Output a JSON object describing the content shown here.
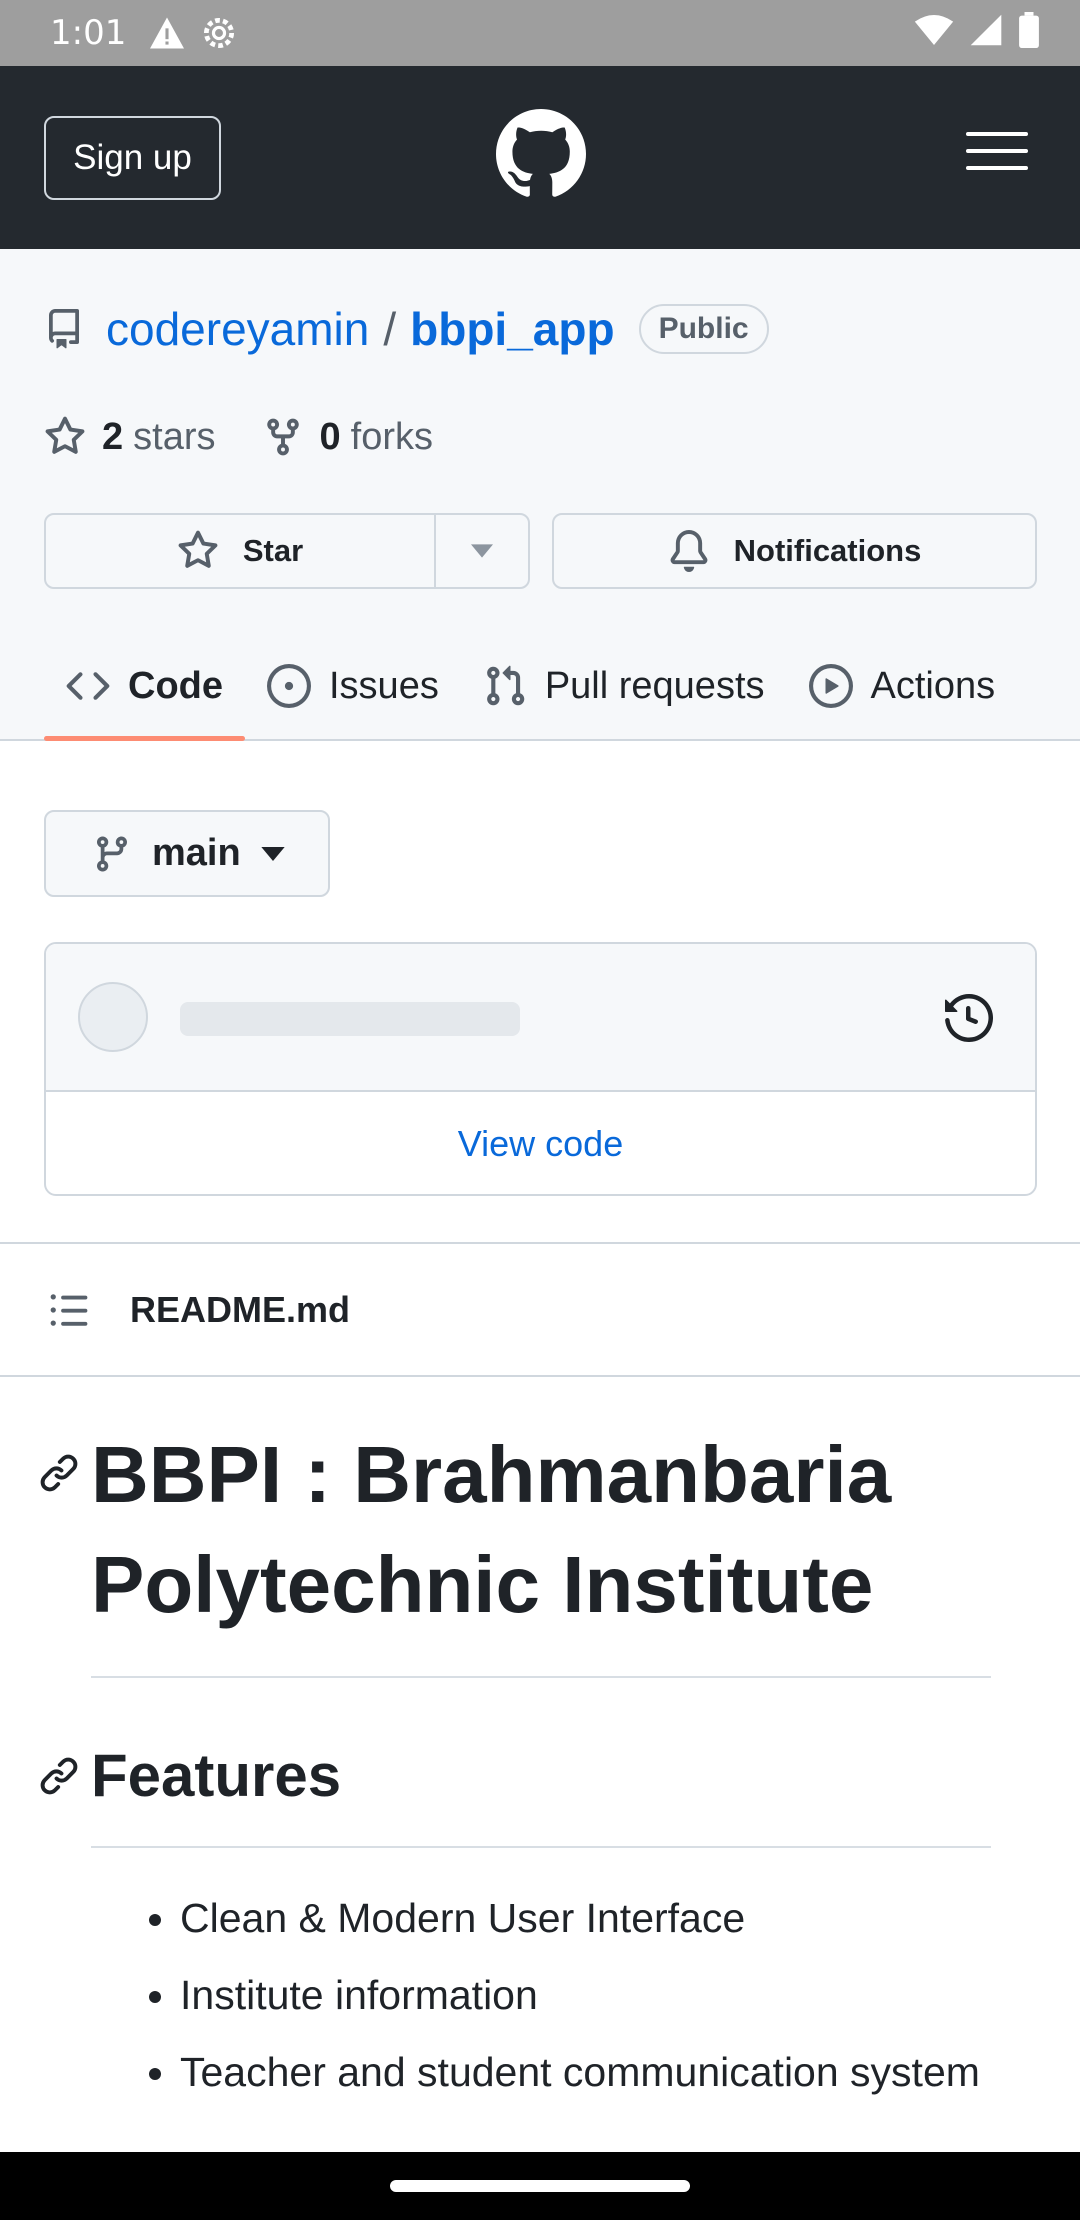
{
  "status_bar": {
    "time": "1:01"
  },
  "header": {
    "signup_label": "Sign up"
  },
  "repo": {
    "owner": "codereyamin",
    "separator": "/",
    "name": "bbpi_app",
    "visibility": "Public",
    "stars_count": "2",
    "stars_label": "stars",
    "forks_count": "0",
    "forks_label": "forks",
    "star_button": "Star",
    "notifications_button": "Notifications"
  },
  "tabs": [
    {
      "label": "Code"
    },
    {
      "label": "Issues"
    },
    {
      "label": "Pull requests"
    },
    {
      "label": "Actions"
    }
  ],
  "branch": {
    "name": "main"
  },
  "commit_box": {
    "view_code": "View code"
  },
  "readme": {
    "filename": "README.md",
    "h1": "BBPI : Brahmanbaria Polytechnic Institute",
    "h2": "Features",
    "features": [
      "Clean & Modern User Interface",
      "Institute information",
      "Teacher and student communication system"
    ]
  },
  "colors": {
    "header_bg": "#24292f",
    "link": "#0969da",
    "active_tab_underline": "#fd8c73"
  }
}
